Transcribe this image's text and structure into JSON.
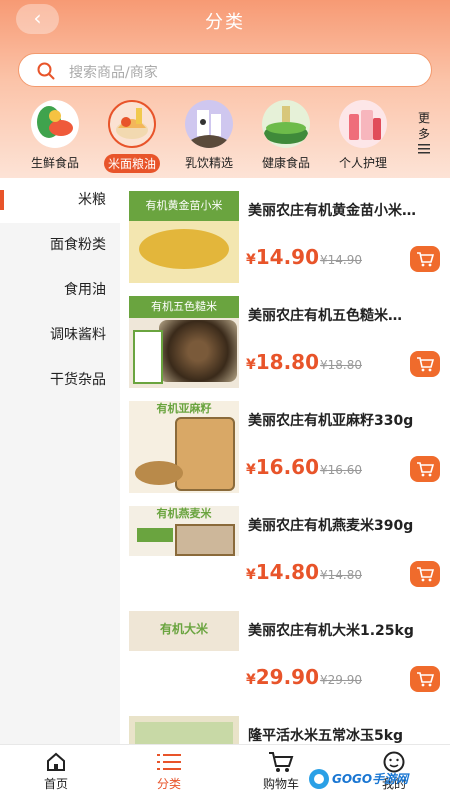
{
  "header": {
    "title": "分类",
    "back_icon": "chevron-left-icon"
  },
  "search": {
    "placeholder": "搜索商品/商家",
    "icon": "search-icon"
  },
  "categories": [
    {
      "label": "生鲜食品",
      "icon": "fresh-food-icon"
    },
    {
      "label": "米面粮油",
      "icon": "grain-oil-icon",
      "active": true
    },
    {
      "label": "乳饮精选",
      "icon": "dairy-drink-icon"
    },
    {
      "label": "健康食品",
      "icon": "healthy-food-icon"
    },
    {
      "label": "个人护理",
      "icon": "personal-care-icon"
    }
  ],
  "more": {
    "label_1": "更",
    "label_2": "多",
    "icon": "menu-lines-icon"
  },
  "sidebar": {
    "items": [
      {
        "label": "米粮",
        "active": true
      },
      {
        "label": "面食粉类"
      },
      {
        "label": "食用油"
      },
      {
        "label": "调味酱料"
      },
      {
        "label": "干货杂品"
      }
    ]
  },
  "products": [
    {
      "name": "美丽农庄有机黄金苗小米…",
      "currency": "¥",
      "price": "14.90",
      "old_price": "¥14.90",
      "thumb_text": "有机黄金苗小米"
    },
    {
      "name": "美丽农庄有机五色糙米…",
      "currency": "¥",
      "price": "18.80",
      "old_price": "¥18.80",
      "thumb_text": "有机五色糙米"
    },
    {
      "name": "美丽农庄有机亚麻籽330g",
      "currency": "¥",
      "price": "16.60",
      "old_price": "¥16.60",
      "thumb_text": "有机亚麻籽"
    },
    {
      "name": "美丽农庄有机燕麦米390g",
      "currency": "¥",
      "price": "14.80",
      "old_price": "¥14.80",
      "thumb_text": "有机燕麦米"
    },
    {
      "name": "美丽农庄有机大米1.25kg",
      "currency": "¥",
      "price": "29.90",
      "old_price": "¥29.90",
      "thumb_text": "有机大米"
    },
    {
      "name": "隆平活水米五常冰玉5kg",
      "currency": "¥",
      "price": "",
      "old_price": "",
      "thumb_text": ""
    }
  ],
  "tabbar": [
    {
      "label": "首页",
      "icon": "home-icon"
    },
    {
      "label": "分类",
      "icon": "list-icon",
      "active": true
    },
    {
      "label": "购物车",
      "icon": "cart-icon"
    },
    {
      "label": "我的",
      "icon": "profile-icon"
    }
  ],
  "watermark": {
    "text": "GOGO手游网"
  },
  "colors": {
    "accent": "#e8542a",
    "cart_button": "#f06b2c",
    "header_top": "#f79a74"
  }
}
